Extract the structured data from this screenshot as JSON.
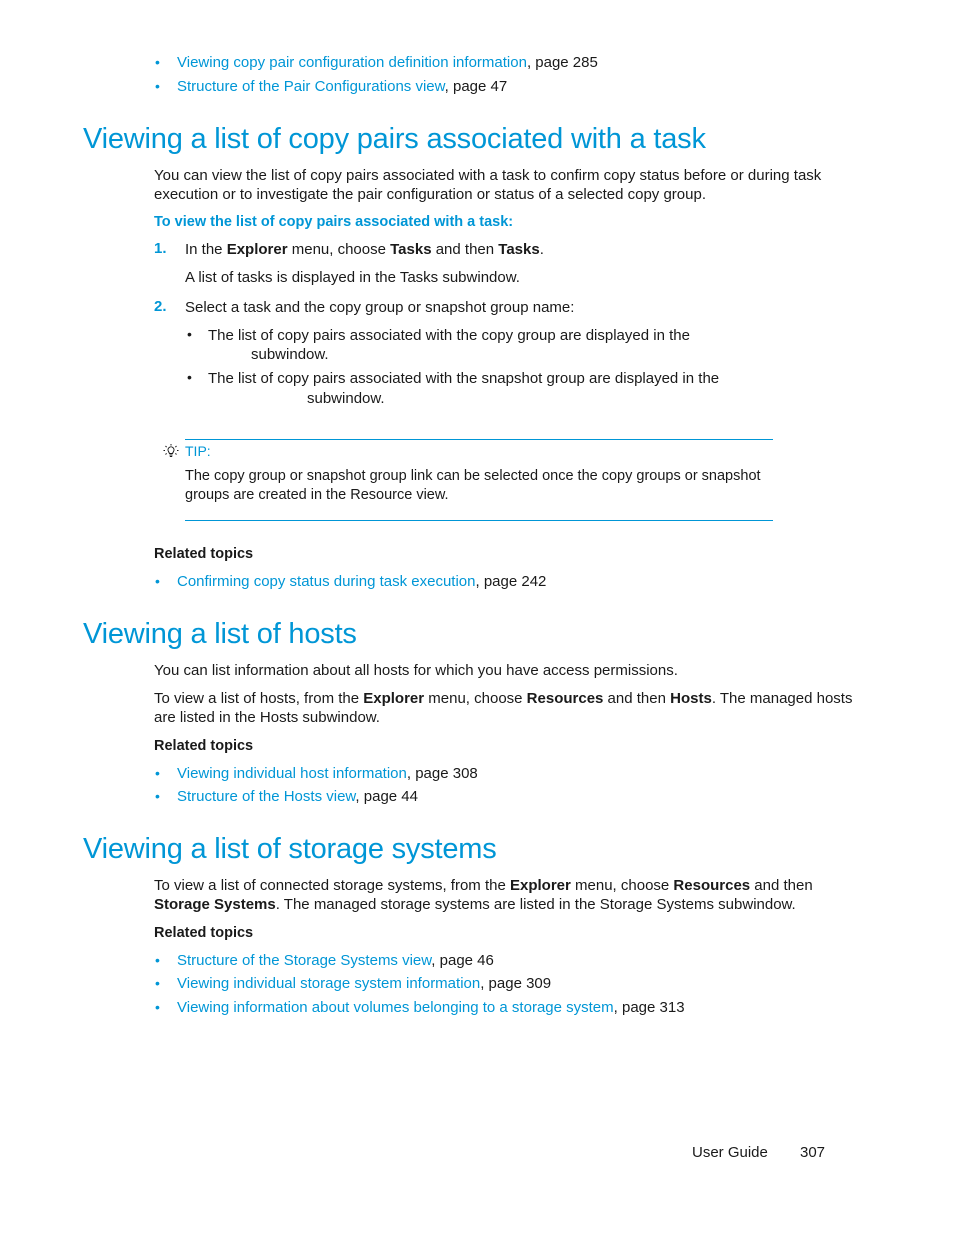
{
  "top_links": [
    {
      "link": "Viewing copy pair configuration definition information",
      "suffix": ", page 285"
    },
    {
      "link": "Structure of the Pair Configurations view",
      "suffix": ", page 47"
    }
  ],
  "section1": {
    "title": "Viewing a list of copy pairs associated with a task",
    "intro_line1": "You can view the list of copy pairs associated with a task to confirm copy status before or during task",
    "intro_line2": "execution or to investigate the pair configuration or status of a selected copy group.",
    "procedure_title": "To view the list of copy pairs associated with a task:",
    "steps": [
      {
        "number": "1.",
        "parts": [
          "In the ",
          "Explorer",
          " menu, choose ",
          "Tasks",
          " and then ",
          "Tasks",
          "."
        ],
        "result": "A list of tasks is displayed in the Tasks subwindow."
      },
      {
        "number": "2.",
        "text": "Select a task and the copy group or snapshot group name:",
        "subitems": [
          {
            "line1": "The list of copy pairs associated with the copy group are displayed in the",
            "line2": "subwindow."
          },
          {
            "line1": "The list of copy pairs associated with the snapshot group are displayed in the",
            "line2": "subwindow."
          }
        ]
      }
    ],
    "tip": {
      "icon": "lightbulb-icon",
      "label": "TIP:",
      "line1": "The copy group or snapshot group link can be selected once the copy groups or snapshot",
      "line2": "groups are created in the Resource view."
    },
    "related_label": "Related topics",
    "related": [
      {
        "link": "Confirming copy status during task execution",
        "suffix": ", page 242"
      }
    ]
  },
  "section2": {
    "title": "Viewing a list of hosts",
    "para1": "You can list information about all hosts for which you have access permissions.",
    "para2_parts": [
      "To view a list of hosts, from the ",
      "Explorer",
      " menu, choose ",
      "Resources",
      " and then ",
      "Hosts",
      ". The managed hosts"
    ],
    "para2_line2": "are listed in the Hosts subwindow.",
    "related_label": "Related topics",
    "related": [
      {
        "link": "Viewing individual host information",
        "suffix": ", page 308"
      },
      {
        "link": "Structure of the Hosts view",
        "suffix": ", page 44"
      }
    ]
  },
  "section3": {
    "title": "Viewing a list of storage systems",
    "para_line1_parts": [
      "To view a list of connected storage systems, from the ",
      "Explorer",
      " menu, choose ",
      "Resources",
      " and then"
    ],
    "para_line2_parts": [
      "Storage Systems",
      ". The managed storage systems are listed in the Storage Systems subwindow."
    ],
    "related_label": "Related topics",
    "related": [
      {
        "link": "Structure of the Storage Systems view",
        "suffix": ", page 46"
      },
      {
        "link": "Viewing individual storage system information",
        "suffix": ", page 309"
      },
      {
        "link": "Viewing information about volumes belonging to a storage system",
        "suffix": ", page 313"
      }
    ]
  },
  "footer": {
    "guide_label": "User Guide",
    "page_number": "307"
  },
  "colors": {
    "accent": "#0096d6",
    "text": "#1a1a1a"
  }
}
